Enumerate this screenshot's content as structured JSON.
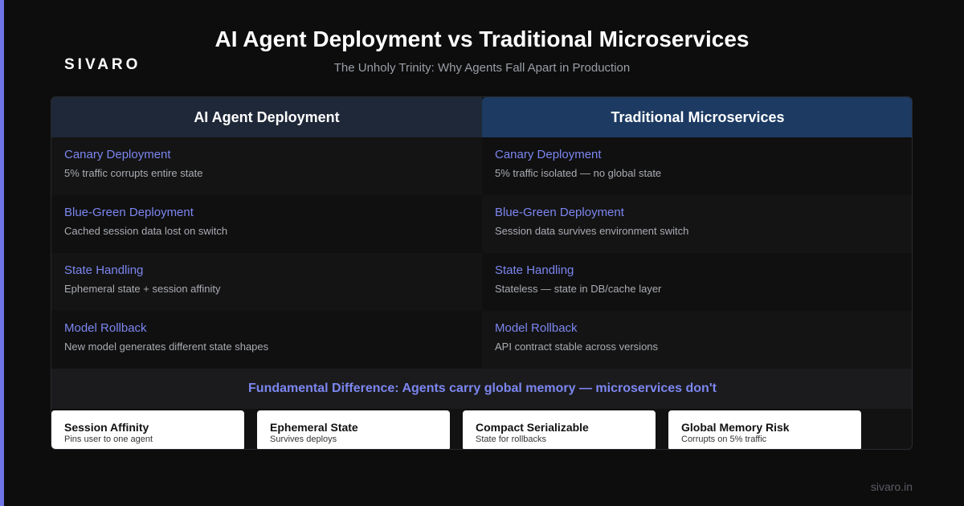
{
  "brand": "SIVARO",
  "title": "AI Agent Deployment vs Traditional Microservices",
  "subtitle": "The Unholy Trinity: Why Agents Fall Apart in Production",
  "columns": {
    "left": "AI Agent Deployment",
    "right": "Traditional Microservices"
  },
  "rows": [
    {
      "left": {
        "title": "Canary Deployment",
        "desc": "5% traffic corrupts entire state"
      },
      "right": {
        "title": "Canary Deployment",
        "desc": "5% traffic isolated — no global state"
      }
    },
    {
      "left": {
        "title": "Blue-Green Deployment",
        "desc": "Cached session data lost on switch"
      },
      "right": {
        "title": "Blue-Green Deployment",
        "desc": "Session data survives environment switch"
      }
    },
    {
      "left": {
        "title": "State Handling",
        "desc": "Ephemeral state + session affinity"
      },
      "right": {
        "title": "State Handling",
        "desc": "Stateless — state in DB/cache layer"
      }
    },
    {
      "left": {
        "title": "Model Rollback",
        "desc": "New model generates different state shapes"
      },
      "right": {
        "title": "Model Rollback",
        "desc": "API contract stable across versions"
      }
    }
  ],
  "banner": "Fundamental Difference: Agents carry global memory — microservices don't",
  "cards": [
    {
      "title": "Session Affinity",
      "desc": "Pins user to one agent"
    },
    {
      "title": "Ephemeral State",
      "desc": "Survives deploys"
    },
    {
      "title": "Compact Serializable",
      "desc": "State for rollbacks"
    },
    {
      "title": "Global Memory Risk",
      "desc": "Corrupts on 5% traffic"
    }
  ],
  "footer": "sivaro.in",
  "colors": {
    "accent": "#7c86f0",
    "left_header": "#1e2838",
    "right_header": "#1c3a62",
    "background": "#0d0d0d",
    "side_bar": "#6f74e6"
  }
}
